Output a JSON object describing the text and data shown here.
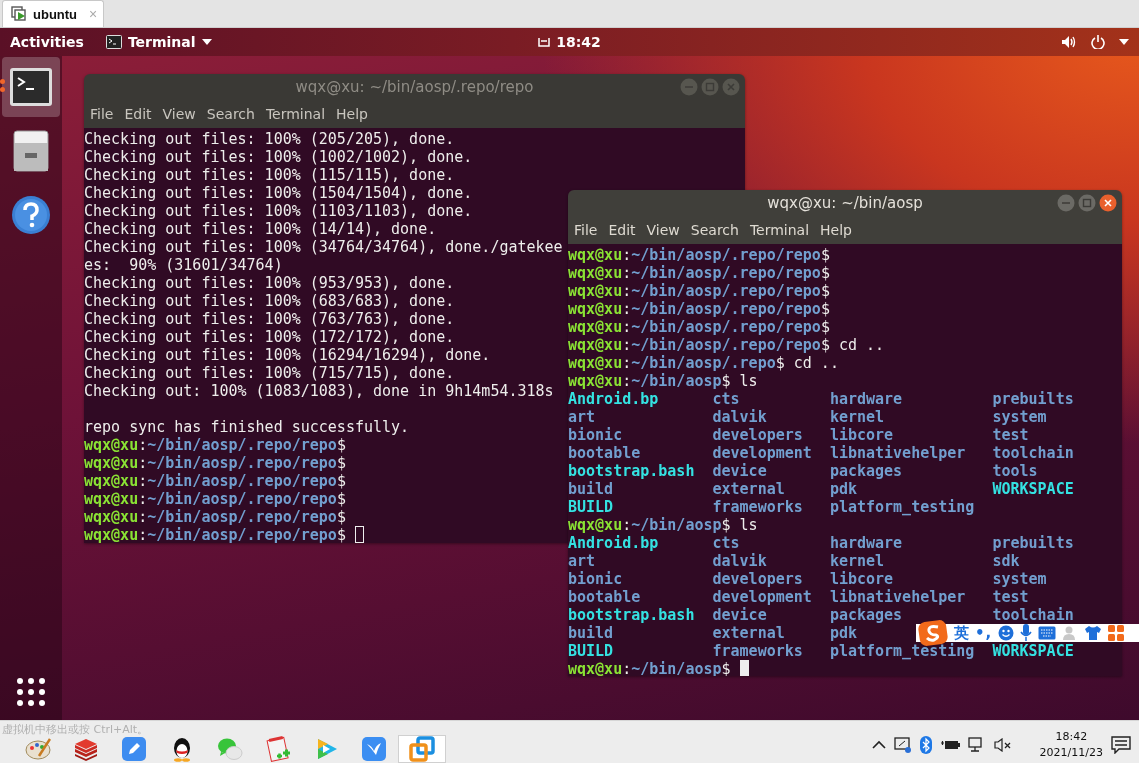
{
  "vm_tab": {
    "title": "ubuntu",
    "close": "×"
  },
  "top_panel": {
    "activities": "Activities",
    "app_menu": "Terminal",
    "clock": "18:42"
  },
  "dock": {
    "items": [
      {
        "kind": "terminal",
        "selected": true,
        "running": true
      },
      {
        "kind": "files",
        "selected": false,
        "running": false
      },
      {
        "kind": "help",
        "selected": false,
        "running": false
      }
    ]
  },
  "windows": [
    {
      "title": "wqx@xu: ~/bin/aosp/.repo/repo",
      "active": false,
      "menu": [
        "File",
        "Edit",
        "View",
        "Search",
        "Terminal",
        "Help"
      ],
      "lines": [
        {
          "kind": "text",
          "text": "Checking out files: 100% (205/205), done."
        },
        {
          "kind": "text",
          "text": "Checking out files: 100% (1002/1002), done."
        },
        {
          "kind": "text",
          "text": "Checking out files: 100% (115/115), done."
        },
        {
          "kind": "text",
          "text": "Checking out files: 100% (1504/1504), done."
        },
        {
          "kind": "text",
          "text": "Checking out files: 100% (1103/1103), done."
        },
        {
          "kind": "text",
          "text": "Checking out files: 100% (14/14), done."
        },
        {
          "kind": "text",
          "text": "Checking out files: 100% (34764/34764), done./gatekee"
        },
        {
          "kind": "text",
          "text": "es:  90% (31601/34764)"
        },
        {
          "kind": "text",
          "text": "Checking out files: 100% (953/953), done."
        },
        {
          "kind": "text",
          "text": "Checking out files: 100% (683/683), done."
        },
        {
          "kind": "text",
          "text": "Checking out files: 100% (763/763), done."
        },
        {
          "kind": "text",
          "text": "Checking out files: 100% (172/172), done."
        },
        {
          "kind": "text",
          "text": "Checking out files: 100% (16294/16294), done."
        },
        {
          "kind": "text",
          "text": "Checking out files: 100% (715/715), done."
        },
        {
          "kind": "text",
          "text": "Checking out: 100% (1083/1083), done in 9h14m54.318s"
        },
        {
          "kind": "blank"
        },
        {
          "kind": "text",
          "text": "repo sync has finished successfully."
        },
        {
          "kind": "prompt",
          "user": "wqx@xu",
          "sep": ":",
          "path": "~/bin/aosp/.repo/repo",
          "tail": "$"
        },
        {
          "kind": "prompt",
          "user": "wqx@xu",
          "sep": ":",
          "path": "~/bin/aosp/.repo/repo",
          "tail": "$"
        },
        {
          "kind": "prompt",
          "user": "wqx@xu",
          "sep": ":",
          "path": "~/bin/aosp/.repo/repo",
          "tail": "$"
        },
        {
          "kind": "prompt",
          "user": "wqx@xu",
          "sep": ":",
          "path": "~/bin/aosp/.repo/repo",
          "tail": "$"
        },
        {
          "kind": "prompt",
          "user": "wqx@xu",
          "sep": ":",
          "path": "~/bin/aosp/.repo/repo",
          "tail": "$"
        },
        {
          "kind": "prompt",
          "user": "wqx@xu",
          "sep": ":",
          "path": "~/bin/aosp/.repo/repo",
          "tail": "$",
          "cursor": true
        }
      ]
    },
    {
      "title": "wqx@xu: ~/bin/aosp",
      "active": true,
      "menu": [
        "File",
        "Edit",
        "View",
        "Search",
        "Terminal",
        "Help"
      ],
      "lines": [
        {
          "kind": "prompt",
          "user": "wqx@xu",
          "sep": ":",
          "path": "~/bin/aosp/.repo/repo",
          "tail": "$"
        },
        {
          "kind": "prompt",
          "user": "wqx@xu",
          "sep": ":",
          "path": "~/bin/aosp/.repo/repo",
          "tail": "$"
        },
        {
          "kind": "prompt",
          "user": "wqx@xu",
          "sep": ":",
          "path": "~/bin/aosp/.repo/repo",
          "tail": "$"
        },
        {
          "kind": "prompt",
          "user": "wqx@xu",
          "sep": ":",
          "path": "~/bin/aosp/.repo/repo",
          "tail": "$"
        },
        {
          "kind": "prompt",
          "user": "wqx@xu",
          "sep": ":",
          "path": "~/bin/aosp/.repo/repo",
          "tail": "$"
        },
        {
          "kind": "prompt",
          "user": "wqx@xu",
          "sep": ":",
          "path": "~/bin/aosp/.repo/repo",
          "tail": "$ cd .."
        },
        {
          "kind": "prompt",
          "user": "wqx@xu",
          "sep": ":",
          "path": "~/bin/aosp/.repo",
          "tail": "$ cd .."
        },
        {
          "kind": "prompt",
          "user": "wqx@xu",
          "sep": ":",
          "path": "~/bin/aosp",
          "tail": "$ ls"
        },
        {
          "kind": "ls",
          "entries": [
            {
              "name": "Android.bp",
              "kind": "link"
            },
            {
              "name": "cts",
              "kind": "dir"
            },
            {
              "name": "hardware",
              "kind": "dir"
            },
            {
              "name": "prebuilts",
              "kind": "dir"
            }
          ]
        },
        {
          "kind": "ls",
          "entries": [
            {
              "name": "art",
              "kind": "dir"
            },
            {
              "name": "dalvik",
              "kind": "dir"
            },
            {
              "name": "kernel",
              "kind": "dir"
            },
            {
              "name": "system",
              "kind": "dir"
            }
          ]
        },
        {
          "kind": "ls",
          "entries": [
            {
              "name": "bionic",
              "kind": "dir"
            },
            {
              "name": "developers",
              "kind": "dir"
            },
            {
              "name": "libcore",
              "kind": "dir"
            },
            {
              "name": "test",
              "kind": "dir"
            }
          ]
        },
        {
          "kind": "ls",
          "entries": [
            {
              "name": "bootable",
              "kind": "dir"
            },
            {
              "name": "development",
              "kind": "dir"
            },
            {
              "name": "libnativehelper",
              "kind": "dir"
            },
            {
              "name": "toolchain",
              "kind": "dir"
            }
          ]
        },
        {
          "kind": "ls",
          "entries": [
            {
              "name": "bootstrap.bash",
              "kind": "link"
            },
            {
              "name": "device",
              "kind": "dir"
            },
            {
              "name": "packages",
              "kind": "dir"
            },
            {
              "name": "tools",
              "kind": "dir"
            }
          ]
        },
        {
          "kind": "ls",
          "entries": [
            {
              "name": "build",
              "kind": "dir"
            },
            {
              "name": "external",
              "kind": "dir"
            },
            {
              "name": "pdk",
              "kind": "dir"
            },
            {
              "name": "WORKSPACE",
              "kind": "link"
            }
          ]
        },
        {
          "kind": "ls",
          "entries": [
            {
              "name": "BUILD",
              "kind": "link"
            },
            {
              "name": "frameworks",
              "kind": "dir"
            },
            {
              "name": "platform_testing",
              "kind": "dir"
            }
          ]
        },
        {
          "kind": "prompt",
          "user": "wqx@xu",
          "sep": ":",
          "path": "~/bin/aosp",
          "tail": "$ ls"
        },
        {
          "kind": "ls",
          "entries": [
            {
              "name": "Android.bp",
              "kind": "link"
            },
            {
              "name": "cts",
              "kind": "dir"
            },
            {
              "name": "hardware",
              "kind": "dir"
            },
            {
              "name": "prebuilts",
              "kind": "dir"
            }
          ]
        },
        {
          "kind": "ls",
          "entries": [
            {
              "name": "art",
              "kind": "dir"
            },
            {
              "name": "dalvik",
              "kind": "dir"
            },
            {
              "name": "kernel",
              "kind": "dir"
            },
            {
              "name": "sdk",
              "kind": "dir"
            }
          ]
        },
        {
          "kind": "ls",
          "entries": [
            {
              "name": "bionic",
              "kind": "dir"
            },
            {
              "name": "developers",
              "kind": "dir"
            },
            {
              "name": "libcore",
              "kind": "dir"
            },
            {
              "name": "system",
              "kind": "dir"
            }
          ]
        },
        {
          "kind": "ls",
          "entries": [
            {
              "name": "bootable",
              "kind": "dir"
            },
            {
              "name": "development",
              "kind": "dir"
            },
            {
              "name": "libnativehelper",
              "kind": "dir"
            },
            {
              "name": "test",
              "kind": "dir"
            }
          ]
        },
        {
          "kind": "ls",
          "entries": [
            {
              "name": "bootstrap.bash",
              "kind": "link"
            },
            {
              "name": "device",
              "kind": "dir"
            },
            {
              "name": "packages",
              "kind": "dir"
            },
            {
              "name": "toolchain",
              "kind": "dir"
            }
          ]
        },
        {
          "kind": "ls",
          "entries": [
            {
              "name": "build",
              "kind": "dir"
            },
            {
              "name": "external",
              "kind": "dir"
            },
            {
              "name": "pdk",
              "kind": "dir"
            }
          ]
        },
        {
          "kind": "ls",
          "entries": [
            {
              "name": "BUILD",
              "kind": "link"
            },
            {
              "name": "frameworks",
              "kind": "dir"
            },
            {
              "name": "platform_testing",
              "kind": "dir"
            },
            {
              "name": "WORKSPACE",
              "kind": "link"
            }
          ]
        },
        {
          "kind": "prompt",
          "user": "wqx@xu",
          "sep": ":",
          "path": "~/bin/aosp",
          "tail": "$",
          "cursor": true
        }
      ]
    }
  ],
  "ime_bar": {
    "mode": "英",
    "punct": "•,"
  },
  "taskbar": {
    "hint": "虚拟机中移出或按 Ctrl+Alt。",
    "apps": [
      {
        "kind": "palette",
        "selected": false
      },
      {
        "kind": "stack",
        "selected": false
      },
      {
        "kind": "pen",
        "selected": false
      },
      {
        "kind": "penguin",
        "selected": false
      },
      {
        "kind": "chat",
        "selected": false
      },
      {
        "kind": "notepad",
        "selected": false
      },
      {
        "kind": "play",
        "selected": false
      },
      {
        "kind": "bird",
        "selected": false
      },
      {
        "kind": "squares",
        "selected": true
      }
    ],
    "time": "18:42",
    "date": "2021/11/23"
  }
}
